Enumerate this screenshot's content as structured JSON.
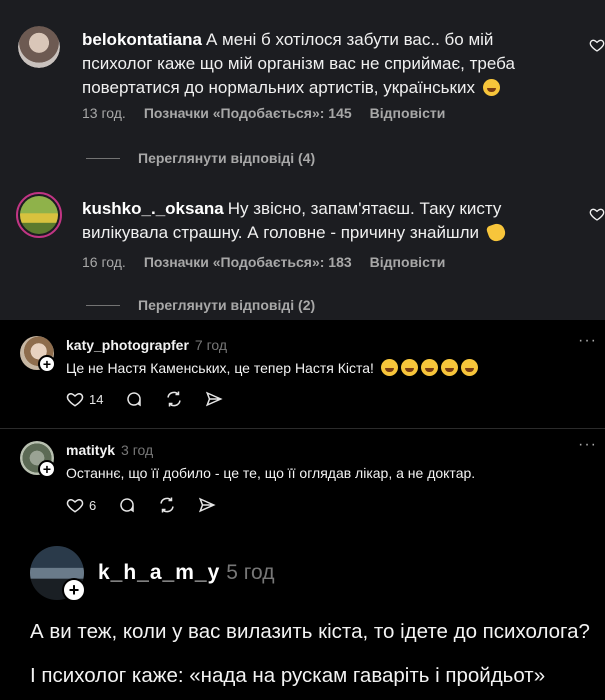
{
  "ig_comments": [
    {
      "username": "belokontatiana",
      "lines": [
        "А мені б хотілося забути вас.. бо мій",
        "психолог каже що мій організм вас не сприймає, треба",
        "повертатися до нормальних артистів, українських"
      ],
      "time": "13 год.",
      "likes_label": "Позначки «Подобається»: 145",
      "reply_label": "Відповісти",
      "view_replies": "Переглянути відповіді (4)",
      "emoji": "grinning-face-emoji"
    },
    {
      "username": "kushko_._oksana",
      "lines": [
        "Ну звісно, запам'ятаєш. Таку кисту",
        "вилікувала страшну. А головне - причину знайшли"
      ],
      "time": "16 год.",
      "likes_label": "Позначки «Подобається»: 183",
      "reply_label": "Відповісти",
      "view_replies": "Переглянути відповіді (2)",
      "emoji": "clapping-hands-emoji"
    }
  ],
  "threads_comments": [
    {
      "username": "katy_photograpfer",
      "time": "7 год",
      "text": "Це не Настя Каменських, це тепер Настя Кіста!",
      "emojis": [
        "laughing-emoji",
        "laughing-emoji",
        "laughing-emoji",
        "laughing-emoji",
        "laughing-emoji"
      ],
      "likes": "14",
      "more": "···"
    },
    {
      "username": "matityk",
      "time": "3 год",
      "text": "Останнє, що її добило - це те, що її оглядав лікар, а не доктар.",
      "likes": "6",
      "more": "···"
    }
  ],
  "post": {
    "username": "k_h_a_m_y",
    "time": "5 год",
    "lines": [
      "А ви теж, коли у вас вилазить кіста, то ідете до психолога?",
      "І психолог каже: «нада на рускам гаваріть і пройдьот»"
    ]
  },
  "colors": {
    "ig_bg": "#1c1d21",
    "threads_bg": "#000000",
    "muted": "#a8a8a8",
    "story_ring": "#c13584"
  }
}
